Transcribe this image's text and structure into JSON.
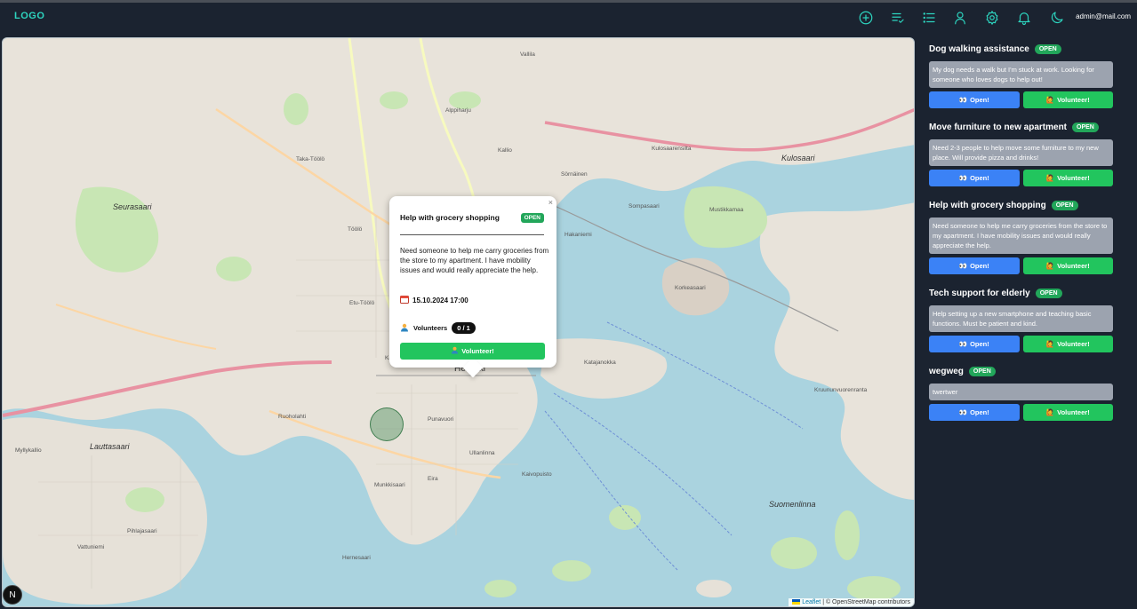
{
  "navbar": {
    "logo": "LOGO",
    "icons": [
      "add-circle-icon",
      "checklist-icon",
      "list-icon",
      "user-icon",
      "gear-icon",
      "bell-icon",
      "moon-icon"
    ],
    "email": "admin@mail.com",
    "accent_color": "#2dd4bf"
  },
  "map": {
    "attribution_leaflet": "Leaflet",
    "attribution_rest": "| © OpenStreetMap contributors",
    "n_logo": "N",
    "labels": {
      "helsinki": "Helsinki",
      "kulosaari": "Kulosaari",
      "seurasaari": "Seurasaari",
      "korkeasaari": "Korkeasaari",
      "suomenlinna": "Suomenlinna",
      "lauttasaari": "Lauttasaari",
      "taka_toolo": "Taka-Töölö",
      "kallio": "Kallio",
      "kamppi": "Kamppi",
      "katajanokka": "Katajanokka",
      "kaivopuisto": "Kaivopuisto",
      "pihlajasaari": "Pihlajasaari",
      "vallila": "Vallila",
      "sornainen": "Sörnäinen",
      "mustikkamaa": "Mustikkamaa",
      "ruoholahti": "Ruoholahti",
      "hernesaari": "Hernesaari",
      "eira": "Eira",
      "punavuori": "Punavuori",
      "ullanlinna": "Ullanlinna",
      "munkkisaari": "Munkkisaari",
      "vattuniemi": "Vattuniemi",
      "myllykallio": "Myllykallio",
      "kulosaari_small": "Kulosaarensilta",
      "toolo": "Töölö",
      "pasila": "Alppiharju",
      "hakaniemi": "Hakaniemi",
      "sompasaari": "Sompasaari",
      "kruunuvuori": "Kruununvuorenranta",
      "etu_toolo": "Etu-Töölö"
    }
  },
  "popup": {
    "title": "Help with grocery shopping",
    "status": "OPEN",
    "close": "×",
    "description": "Need someone to help me carry groceries from the store to my apartment. I have mobility issues and would really appreciate the help.",
    "date": "15.10.2024 17:00",
    "volunteers_label": "Volunteers",
    "volunteers_count": "0 / 1",
    "volunteer_button": "Volunteer!"
  },
  "tasks": [
    {
      "title": "Dog walking assistance",
      "status": "OPEN",
      "description": "My dog needs a walk but I'm stuck at work. Looking for someone who loves dogs to help out!",
      "open_label": "Open!",
      "volunteer_label": "Volunteer!"
    },
    {
      "title": "Move furniture to new apartment",
      "status": "OPEN",
      "description": "Need 2-3 people to help move some furniture to my new place. Will provide pizza and drinks!",
      "open_label": "Open!",
      "volunteer_label": "Volunteer!"
    },
    {
      "title": "Help with grocery shopping",
      "status": "OPEN",
      "description": "Need someone to help me carry groceries from the store to my apartment. I have mobility issues and would really appreciate the help.",
      "open_label": "Open!",
      "volunteer_label": "Volunteer!"
    },
    {
      "title": "Tech support for elderly",
      "status": "OPEN",
      "description": "Help setting up a new smartphone and teaching basic functions. Must be patient and kind.",
      "open_label": "Open!",
      "volunteer_label": "Volunteer!"
    },
    {
      "title": "wegweg",
      "status": "OPEN",
      "description": "twertwer",
      "open_label": "Open!",
      "volunteer_label": "Volunteer!"
    }
  ]
}
